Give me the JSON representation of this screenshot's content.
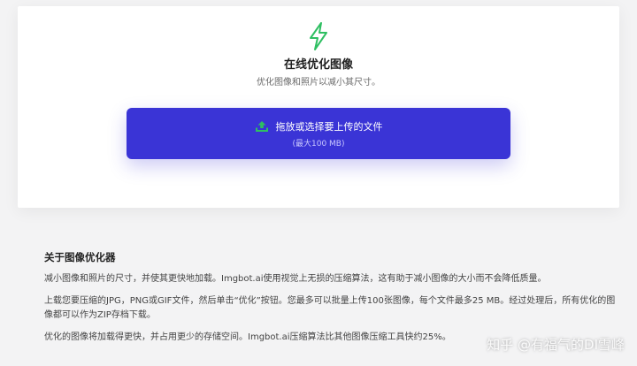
{
  "header": {
    "icon": "lightning-bolt-icon",
    "title": "在线优化图像",
    "subtitle": "优化图像和照片以减小其尺寸。"
  },
  "upload": {
    "icon": "upload-icon",
    "label": "拖放或选择要上传的文件",
    "limit": "(最大100 MB)"
  },
  "about": {
    "heading": "关于图像优化器",
    "paragraphs": [
      "减小图像和照片的尺寸，并使其更快地加载。Imgbot.ai使用视觉上无损的压缩算法，这有助于减小图像的大小而不会降低质量。",
      "上载您要压缩的JPG，PNG或GIF文件，然后单击“优化”按钮。您最多可以批量上传100张图像，每个文件最多25 MB。经过处理后，所有优化的图像都可以作为ZIP存档下载。",
      "优化的图像将加载得更快，并占用更少的存储空间。Imgbot.ai压缩算法比其他图像压缩工具快约25%。"
    ]
  },
  "watermark": {
    "text": "知乎 @有福气的DI雪峰"
  },
  "colors": {
    "accent": "#3a34d6",
    "bolt": "#2fbf62",
    "upload_icon": "#2fbf62",
    "background": "#f3f3f4"
  }
}
